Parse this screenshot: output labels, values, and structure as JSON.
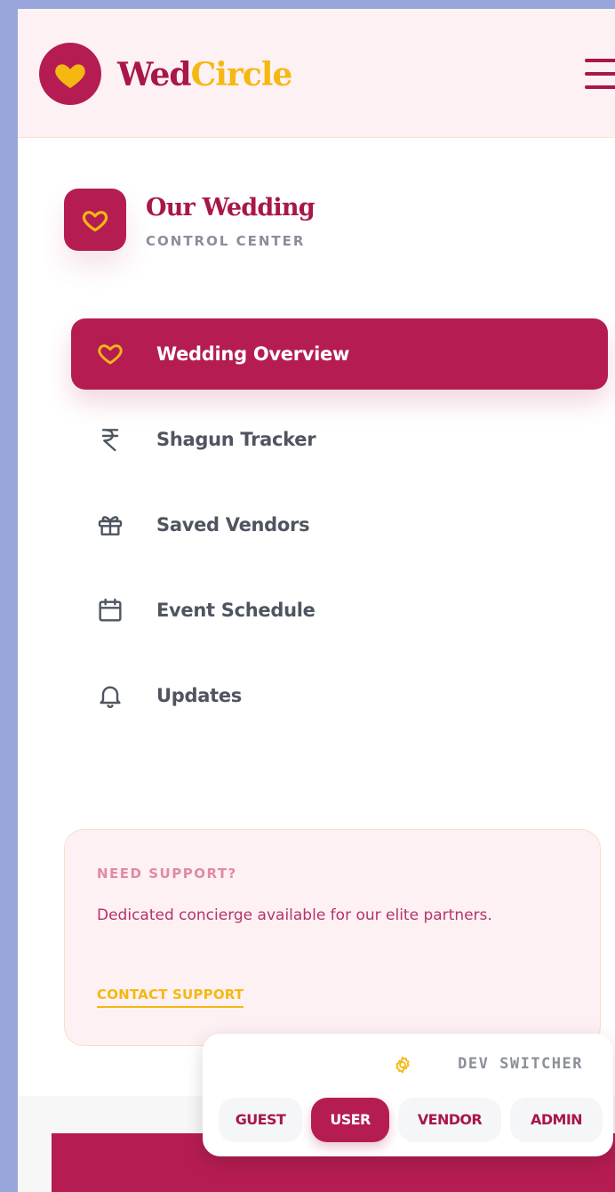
{
  "brand": {
    "name_part1": "Wed",
    "name_part2": "Circle",
    "logo_icon": "heart-icon",
    "menu_icon": "hamburger-menu-icon"
  },
  "wedding": {
    "title": "Our Wedding",
    "subtitle": "CONTROL CENTER",
    "icon": "heart-outline-icon"
  },
  "nav": {
    "items": [
      {
        "label": "Wedding Overview",
        "icon": "heart-outline-icon",
        "active": true
      },
      {
        "label": "Shagun Tracker",
        "icon": "rupee-icon",
        "active": false
      },
      {
        "label": "Saved Vendors",
        "icon": "gift-icon",
        "active": false
      },
      {
        "label": "Event Schedule",
        "icon": "calendar-icon",
        "active": false
      },
      {
        "label": "Updates",
        "icon": "bell-icon",
        "active": false
      }
    ]
  },
  "support": {
    "title": "NEED SUPPORT?",
    "text": "Dedicated concierge available for our elite partners.",
    "link": "CONTACT SUPPORT"
  },
  "dev_switcher": {
    "title": "DEV SWITCHER",
    "icon": "gear-icon",
    "options": [
      "GUEST",
      "USER",
      "VENDOR",
      "ADMIN"
    ],
    "selected": "USER"
  },
  "colors": {
    "primary": "#b51d52",
    "primary_dark": "#a8174a",
    "accent": "#f5b812",
    "header_bg": "#fdf1f4",
    "text_gray": "#4f5560",
    "page_bg": "#98a6dc"
  }
}
